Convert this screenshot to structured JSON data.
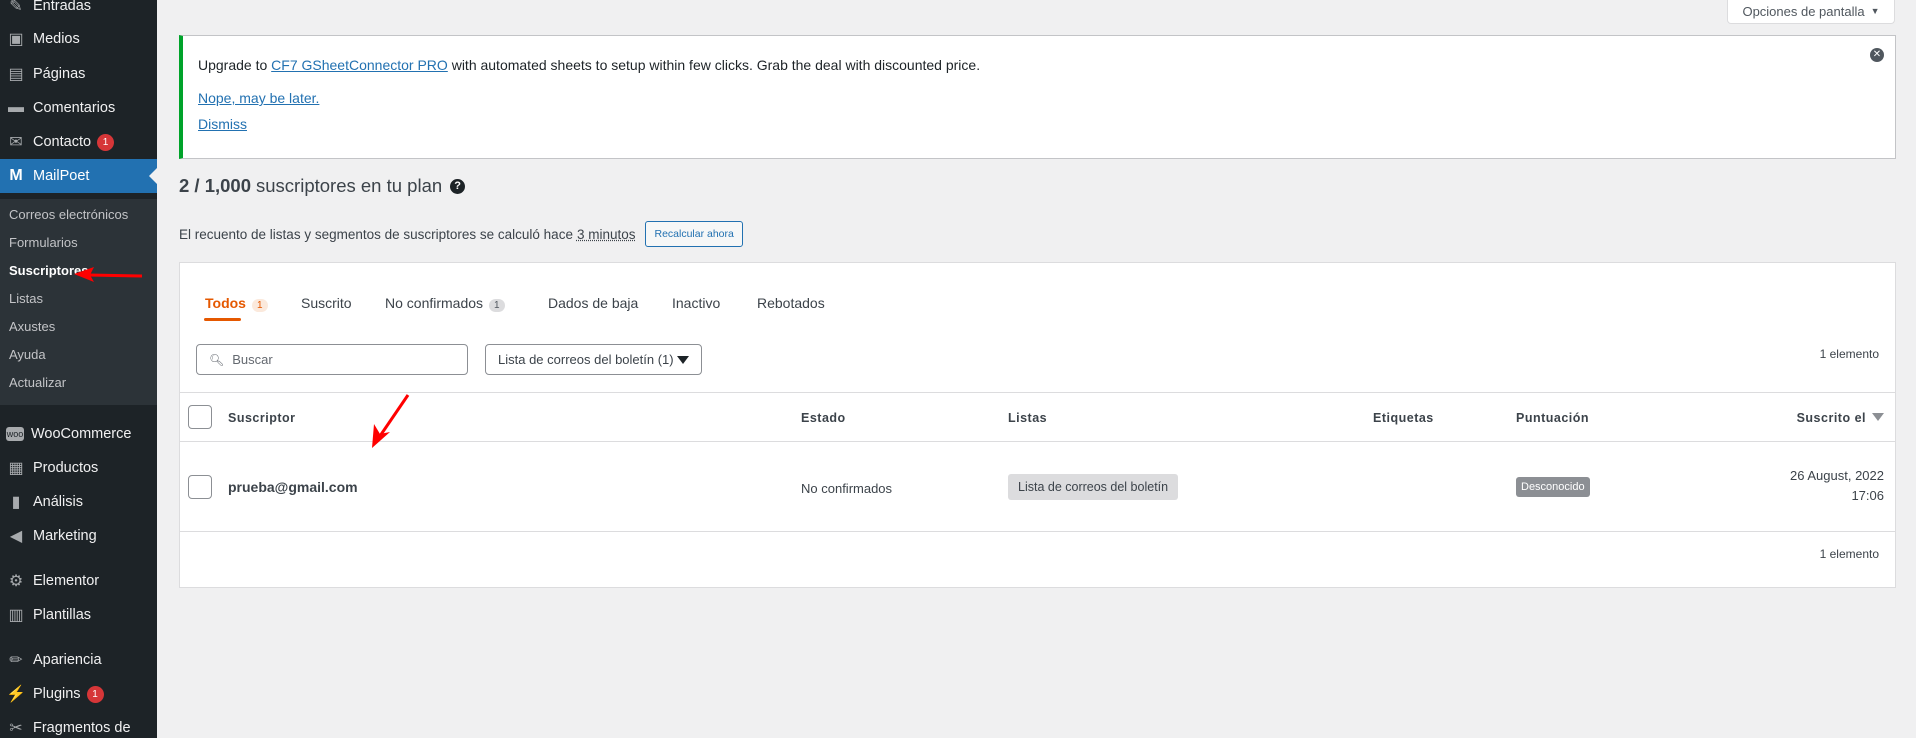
{
  "sidebar": {
    "items": [
      {
        "label": "Entradas",
        "icon": "pin-icon"
      },
      {
        "label": "Medios",
        "icon": "media-icon"
      },
      {
        "label": "Páginas",
        "icon": "pages-icon"
      },
      {
        "label": "Comentarios",
        "icon": "comments-icon"
      },
      {
        "label": "Contacto",
        "icon": "mail-icon",
        "badge": "1"
      },
      {
        "label": "MailPoet",
        "icon": "mailpoet-icon"
      },
      {
        "label": "WooCommerce",
        "icon": "woo-icon"
      },
      {
        "label": "Productos",
        "icon": "products-icon"
      },
      {
        "label": "Análisis",
        "icon": "analytics-icon"
      },
      {
        "label": "Marketing",
        "icon": "megaphone-icon"
      },
      {
        "label": "Elementor",
        "icon": "elementor-icon"
      },
      {
        "label": "Plantillas",
        "icon": "templates-icon"
      },
      {
        "label": "Apariencia",
        "icon": "brush-icon"
      },
      {
        "label": "Plugins",
        "icon": "plugin-icon",
        "badge": "1"
      },
      {
        "label": "Fragmentos de",
        "icon": "scissors-icon"
      }
    ],
    "submenu": [
      "Correos electrónicos",
      "Formularios",
      "Suscriptores",
      "Listas",
      "Axustes",
      "Ayuda",
      "Actualizar"
    ]
  },
  "screen_options": "Opciones de pantalla",
  "notice": {
    "text_before": "Upgrade to ",
    "link": "CF7 GSheetConnector PRO",
    "text_after": " with automated sheets to setup within few clicks. Grab the deal with discounted price.",
    "later": "Nope, may be later.",
    "dismiss": "Dismiss"
  },
  "plan": {
    "count": "2 / 1,000",
    "text": "suscriptores en tu plan"
  },
  "recount": {
    "text": "El recuento de listas y segmentos de suscriptores se calculó hace",
    "time": "3 minutos",
    "button": "Recalcular ahora"
  },
  "tabs": [
    {
      "label": "Todos",
      "count": "1"
    },
    {
      "label": "Suscrito"
    },
    {
      "label": "No confirmados",
      "count": "1"
    },
    {
      "label": "Dados de baja"
    },
    {
      "label": "Inactivo"
    },
    {
      "label": "Rebotados"
    }
  ],
  "search_placeholder": "Buscar",
  "list_filter": "Lista de correos del boletín (1)",
  "item_count": "1 elemento",
  "columns": {
    "subscriber": "Suscriptor",
    "status": "Estado",
    "lists": "Listas",
    "tags": "Etiquetas",
    "score": "Puntuación",
    "subscribed": "Suscrito el"
  },
  "row": {
    "email": "prueba@gmail.com",
    "status": "No confirmados",
    "list": "Lista de correos del boletín",
    "score": "Desconocido",
    "date": "26 August, 2022",
    "time": "17:06"
  },
  "colors": {
    "accent": "#e55800",
    "wp_blue": "#2271b1",
    "sidebar": "#1d2327",
    "annotation": "#ff0000"
  }
}
